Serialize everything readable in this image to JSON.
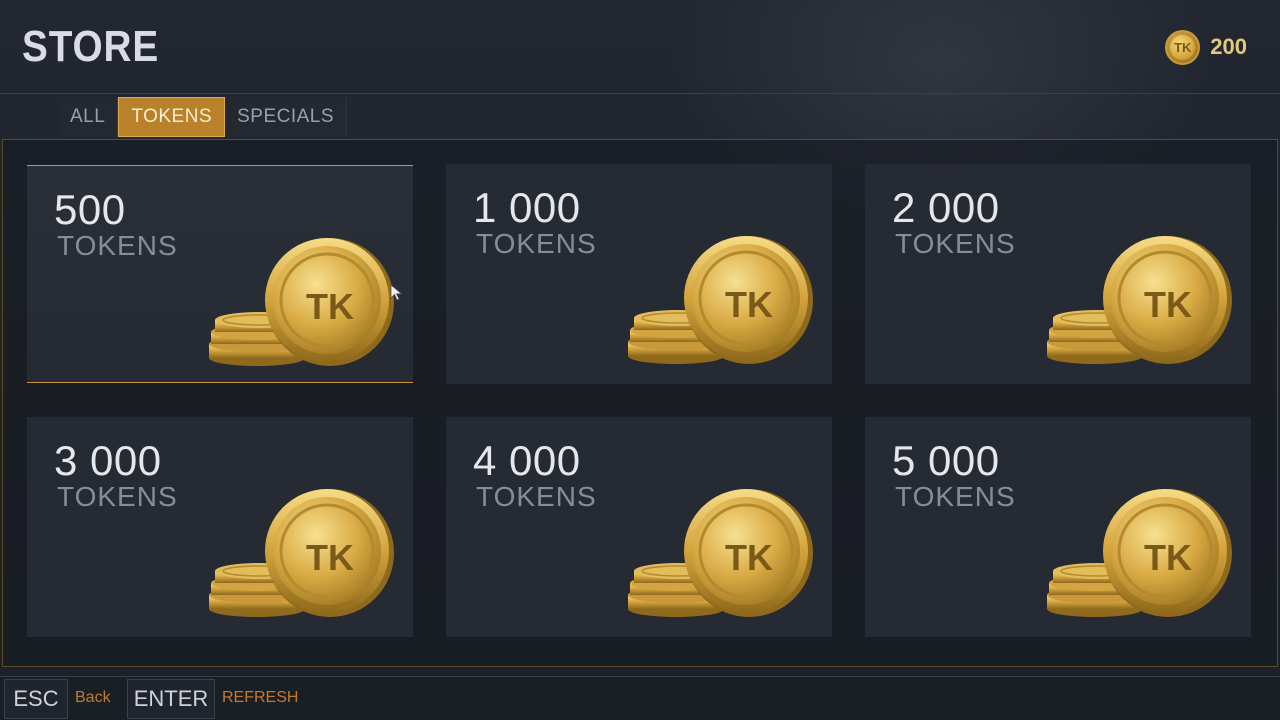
{
  "header": {
    "title": "STORE",
    "currency_icon": "tk-coin-icon",
    "currency_icon_text": "TK",
    "balance": "200"
  },
  "tabs": [
    {
      "label": "ALL",
      "active": false
    },
    {
      "label": "TOKENS",
      "active": true
    },
    {
      "label": "SPECIALS",
      "active": false
    }
  ],
  "store_items": [
    {
      "amount": "500",
      "unit": "TOKENS",
      "selected": true,
      "icon": "tk-coin-stack-icon",
      "coin_text": "TK"
    },
    {
      "amount": "1 000",
      "unit": "TOKENS",
      "selected": false,
      "icon": "tk-coin-stack-icon",
      "coin_text": "TK"
    },
    {
      "amount": "2 000",
      "unit": "TOKENS",
      "selected": false,
      "icon": "tk-coin-stack-icon",
      "coin_text": "TK"
    },
    {
      "amount": "3 000",
      "unit": "TOKENS",
      "selected": false,
      "icon": "tk-coin-stack-icon",
      "coin_text": "TK"
    },
    {
      "amount": "4 000",
      "unit": "TOKENS",
      "selected": false,
      "icon": "tk-coin-stack-icon",
      "coin_text": "TK"
    },
    {
      "amount": "5 000",
      "unit": "TOKENS",
      "selected": false,
      "icon": "tk-coin-stack-icon",
      "coin_text": "TK"
    }
  ],
  "footer": {
    "esc_key": "ESC",
    "esc_label": "Back",
    "enter_key": "ENTER",
    "enter_label": "REFRESH"
  },
  "colors": {
    "accent": "#b9822a",
    "gold": "#e3c97e",
    "background": "#1d2129",
    "card": "#252a33",
    "hint_text": "#c47a2a"
  }
}
